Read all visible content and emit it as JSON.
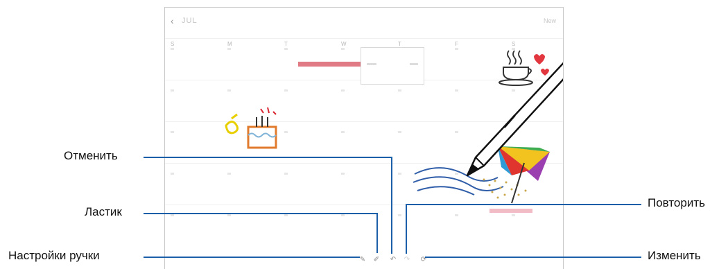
{
  "annotations": {
    "undo": "Отменить",
    "eraser": "Ластик",
    "pen_settings": "Настройки ручки",
    "redo": "Повторить",
    "edit": "Изменить"
  },
  "calendar": {
    "back_glyph": "‹",
    "month": "JUL",
    "new_label": "New",
    "week_days": [
      "S",
      "M",
      "T",
      "W",
      "T",
      "F",
      "S"
    ]
  },
  "toolbar": {
    "icons": [
      "pen-settings-icon",
      "eraser-icon",
      "undo-icon",
      "redo-icon",
      "edit-icon"
    ]
  },
  "colors": {
    "callout_line": "#1b5fa8",
    "event_red": "#e07b86",
    "event_pink": "#f1bcc6",
    "pen_body": "#ffffff",
    "pen_outline": "#111111"
  }
}
